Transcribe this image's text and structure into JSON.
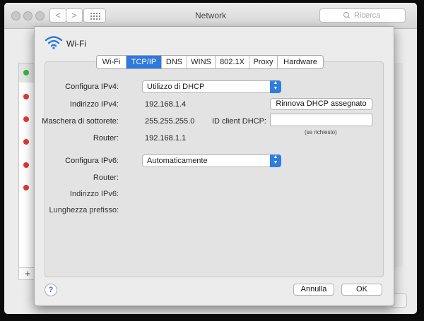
{
  "window": {
    "title": "Network",
    "search_placeholder": "Ricerca",
    "nav_back": "<",
    "nav_forward": ">",
    "add_label": "+",
    "service_status_colors": [
      "#2fbb3c",
      "#df3a33",
      "#df3a33",
      "#df3a33",
      "#df3a33",
      "#df3a33"
    ]
  },
  "sheet": {
    "interface_name": "Wi-Fi",
    "tabs": [
      {
        "label": "Wi-Fi",
        "active": false
      },
      {
        "label": "TCP/IP",
        "active": true
      },
      {
        "label": "DNS",
        "active": false
      },
      {
        "label": "WINS",
        "active": false
      },
      {
        "label": "802.1X",
        "active": false
      },
      {
        "label": "Proxy",
        "active": false
      },
      {
        "label": "Hardware",
        "active": false
      }
    ],
    "ipv4": {
      "config_label": "Configura IPv4:",
      "config_value": "Utilizzo di DHCP",
      "address_label": "Indirizzo IPv4:",
      "address_value": "192.168.1.4",
      "mask_label": "Maschera di sottorete:",
      "mask_value": "255.255.255.0",
      "router_label": "Router:",
      "router_value": "192.168.1.1",
      "renew_button": "Rinnova DHCP assegnato",
      "client_id_label": "ID client DHCP:",
      "client_id_value": "",
      "client_id_hint": "(se richiesto)"
    },
    "ipv6": {
      "config_label": "Configura IPv6:",
      "config_value": "Automaticamente",
      "router_label": "Router:",
      "address_label": "Indirizzo IPv6:",
      "prefix_label": "Lunghezza prefisso:"
    },
    "help_label": "?",
    "cancel_button": "Annulla",
    "ok_button": "OK",
    "accent_color": "#2e79dd"
  }
}
